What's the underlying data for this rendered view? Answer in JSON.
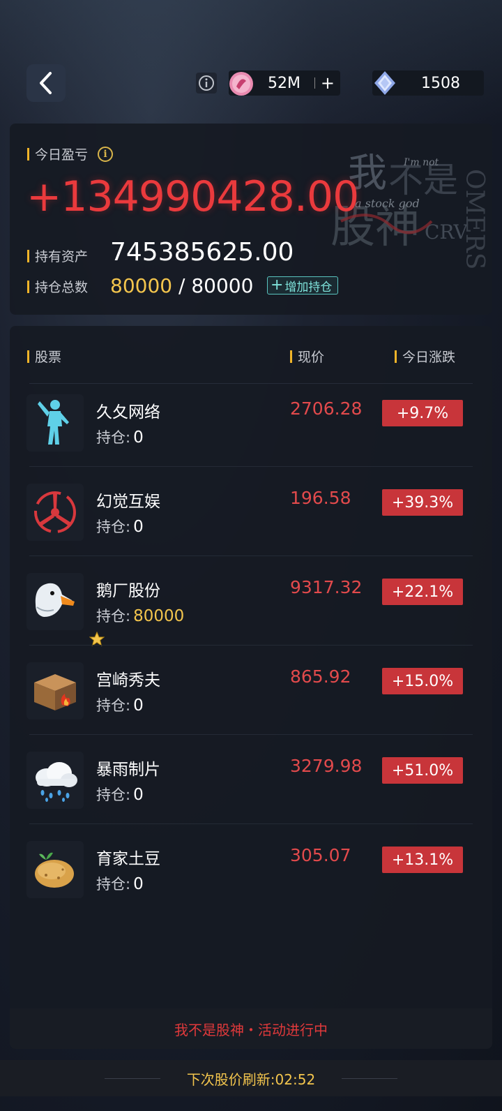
{
  "header": {
    "coin_amount": "52M",
    "gem_amount": "1508",
    "plus": "+"
  },
  "summary": {
    "today_label": "今日盈亏",
    "today_info": "i",
    "today_profit": "+134990428.00",
    "assets_label": "持有资产",
    "assets_value": "745385625.00",
    "positions_label": "持仓总数",
    "positions_current": "80000",
    "positions_sep": " / ",
    "positions_max": "80000",
    "add_position_plus": "+",
    "add_position_label": "增加持仓"
  },
  "table": {
    "col_stock": "股票",
    "col_price": "现价",
    "col_change": "今日涨跌",
    "hold_label": "持仓:",
    "rows": [
      {
        "name": "久夂网络",
        "hold": "0",
        "price": "2706.28",
        "change": "+9.7%",
        "icon": "dancer-icon"
      },
      {
        "name": "幻觉互娱",
        "hold": "0",
        "price": "196.58",
        "change": "+39.3%",
        "icon": "propeller-icon"
      },
      {
        "name": "鹅厂股份",
        "hold": "80000",
        "price": "9317.32",
        "change": "+22.1%",
        "icon": "goose-icon"
      },
      {
        "name": "宫崎秀夫",
        "hold": "0",
        "price": "865.92",
        "change": "+15.0%",
        "icon": "burning-box-icon"
      },
      {
        "name": "暴雨制片",
        "hold": "0",
        "price": "3279.98",
        "change": "+51.0%",
        "icon": "rain-cloud-icon"
      },
      {
        "name": "育家土豆",
        "hold": "0",
        "price": "305.07",
        "change": "+13.1%",
        "icon": "potato-icon"
      }
    ]
  },
  "activity_text": "我不是股神・活动进行中",
  "refresh_text": "下次股价刷新:02:52",
  "colors": {
    "accent_gold": "#f3c54d",
    "up_red": "#c8353a",
    "profit_red": "#ea3a3d",
    "teal": "#7fe3db"
  }
}
